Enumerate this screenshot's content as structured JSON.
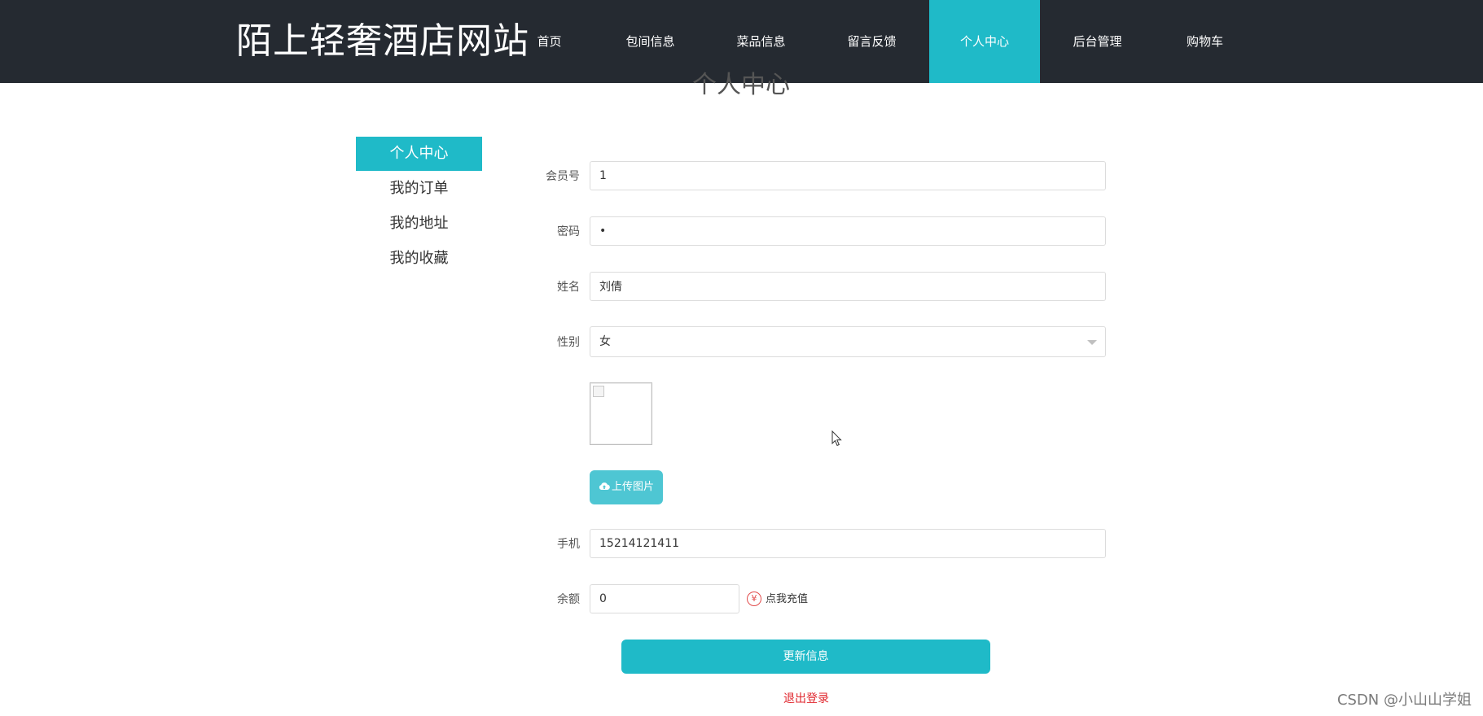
{
  "header": {
    "site_title": "陌上轻奢酒店网站",
    "nav": [
      {
        "label": "首页"
      },
      {
        "label": "包间信息"
      },
      {
        "label": "菜品信息"
      },
      {
        "label": "留言反馈"
      },
      {
        "label": "个人中心",
        "active": true
      },
      {
        "label": "后台管理"
      },
      {
        "label": "购物车"
      }
    ]
  },
  "page": {
    "heading": "个人中心"
  },
  "sidebar": {
    "items": [
      {
        "label": "个人中心",
        "active": true
      },
      {
        "label": "我的订单"
      },
      {
        "label": "我的地址"
      },
      {
        "label": "我的收藏"
      }
    ]
  },
  "form": {
    "member_no": {
      "label": "会员号",
      "value": "1"
    },
    "password": {
      "label": "密码",
      "value": "•"
    },
    "name": {
      "label": "姓名",
      "value": "刘倩"
    },
    "gender": {
      "label": "性别",
      "value": "女"
    },
    "upload_label": "上传图片",
    "phone": {
      "label": "手机",
      "value": "15214121411"
    },
    "balance": {
      "label": "余额",
      "value": "0"
    },
    "recharge_symbol": "¥",
    "recharge_label": "点我充值",
    "update_label": "更新信息",
    "logout_label": "退出登录"
  },
  "watermark": "CSDN @小山山学姐",
  "colors": {
    "nav_bg": "#252a31",
    "accent": "#1fbac8",
    "upload_btn": "#4ec6d3",
    "logout": "#e0252c"
  },
  "icons": {
    "upload": "cloud-upload-icon",
    "recharge": "yen-icon",
    "dropdown": "chevron-down-icon"
  }
}
